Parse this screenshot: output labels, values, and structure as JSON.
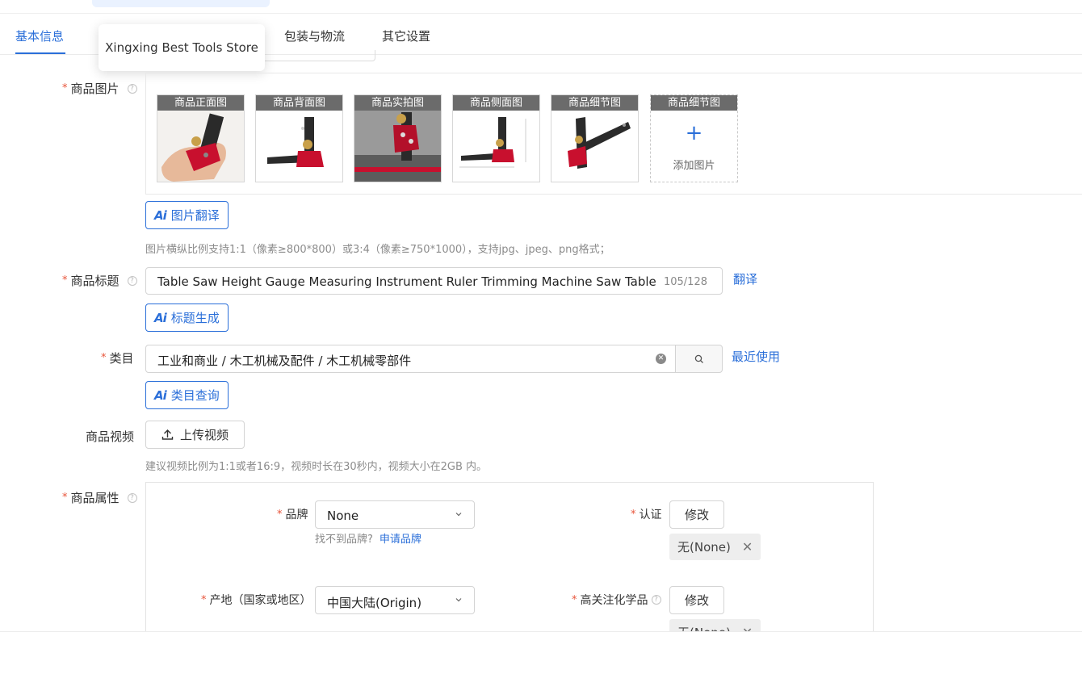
{
  "colors": {
    "accent": "#2b6fd9",
    "required": "#e8543a"
  },
  "tabs": [
    {
      "label": "基本信息",
      "active": true
    },
    {
      "label": "包装与物流",
      "active": false
    },
    {
      "label": "其它设置",
      "active": false
    }
  ],
  "tooltip": {
    "text": "Xingxing Best Tools Store"
  },
  "images": {
    "label": "商品图片",
    "thumbs": [
      {
        "caption": "商品正面图"
      },
      {
        "caption": "商品背面图"
      },
      {
        "caption": "商品实拍图"
      },
      {
        "caption": "商品侧面图"
      },
      {
        "caption": "商品细节图"
      }
    ],
    "add_caption": "商品细节图",
    "add_icon": "plus-icon",
    "add_text": "添加图片",
    "ai_button": "图片翻译",
    "hint": "图片横纵比例支持1:1（像素≥800*800）或3:4（像素≥750*1000），支持jpg、jpeg、png格式；"
  },
  "title": {
    "label": "商品标题",
    "value": "Table Saw Height Gauge Measuring Instrument Ruler Trimming Machine Saw Table Adjustment Tool",
    "count": "105/128",
    "translate_link": "翻译",
    "ai_button": "标题生成"
  },
  "category": {
    "label": "类目",
    "value": "工业和商业 / 木工机械及配件 / 木工机械零部件",
    "recent_link": "最近使用",
    "ai_button": "类目查询"
  },
  "video": {
    "label": "商品视频",
    "upload_button": "上传视频",
    "hint": "建议视频比例为1:1或者16:9，视频时长在30秒内，视频大小在2GB 内。"
  },
  "attributes": {
    "label": "商品属性",
    "brand": {
      "label": "品牌",
      "value": "None",
      "hint": "找不到品牌?",
      "apply_link": "申请品牌"
    },
    "certification": {
      "label": "认证",
      "modify_button": "修改",
      "tag": "无(None)"
    },
    "origin": {
      "label": "产地（国家或地区）",
      "value": "中国大陆(Origin)"
    },
    "chemicals": {
      "label": "高关注化学品",
      "modify_button": "修改",
      "tag": "无(None)"
    }
  }
}
